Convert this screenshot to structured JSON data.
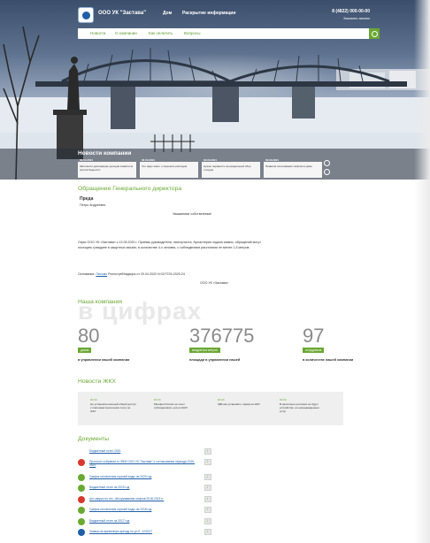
{
  "header": {
    "company": "ООО УК \"Застава\"",
    "nav": [
      "Дом",
      "Раскрытие информации"
    ],
    "phone": "8 (4822) 000-00-00",
    "callback": "Заказать звонок"
  },
  "menu": {
    "items": [
      "Новости",
      "О компании",
      "Как оплатить",
      "Вопросы"
    ]
  },
  "news": {
    "title": "Новости компании",
    "items": [
      {
        "date": "00.00.2021",
        "text": "Заполните декларацию доходов заявителя против бедности"
      },
      {
        "date": "00.00.2021",
        "text": "Что надо знать о переносе расходов"
      },
      {
        "date": "00.00.2021",
        "text": "Нужно перевести на раздельный сбор отходов"
      },
      {
        "date": "00.00.2021",
        "text": "Правила пользования лифтом в доме"
      }
    ]
  },
  "director": {
    "heading": "Обращение Генерального директора",
    "name": "Преда",
    "patronymic": "Петро Андреевич",
    "greeting": "Уважаемые собственники!",
    "body_line1": "Офис ООО УК «Застава» с 12.05.2020 г. Приемы руководителя, паспортиста, бухгалтерия подача заявок, обращений могут",
    "body_line2": "посещать граждане в защитных масках, в количестве 4-х человек, с соблюдением расстояния не менее 1,5 метров.",
    "basis_prefix": "Основание: ",
    "basis_link": "Письмо",
    "basis_rest": " Роспотребнадзора от 20.04.2020 N 02/7376-2020-24",
    "signature": "ООО УК «Застава»"
  },
  "stats": {
    "heading": "Наша компания",
    "watermark": "в цифрах",
    "items": [
      {
        "number": "80",
        "badge": "домов",
        "desc": "в управлении нашей компании"
      },
      {
        "number": "376775",
        "badge": "квадратных метров",
        "desc": "площади в управлении нашей"
      },
      {
        "number": "97",
        "badge": "сотрудников",
        "desc": "в количестве нашей компании"
      }
    ]
  },
  "zhkh": {
    "heading": "Новости ЖКХ",
    "items": [
      {
        "date": "00.00",
        "text": "Не установлен вечный общий доступ к платежам пресечения счету за ЖКУ"
      },
      {
        "date": "00.00",
        "text": "Минфин России не хочет субсидировать услуги ЖКХ"
      },
      {
        "date": "00.00",
        "text": "ГДБ как установить тариф на ЖКУ"
      },
      {
        "date": "00.00",
        "text": "В различных регионах не будут устройства, но непредвиденных услуг"
      }
    ]
  },
  "documents": {
    "heading": "Документы",
    "items": [
      {
        "icon": "blue",
        "text": "Бюджетный отчет 2020"
      },
      {
        "icon": "red",
        "text": "Протокол собрания от ФФИ ООО УК \"Застава\" о согласовании периода 2020-2021"
      },
      {
        "icon": "green",
        "text": "График отключения горячей воды на 2020 год"
      },
      {
        "icon": "green",
        "text": "Бюджетный отчет за 2019 год"
      },
      {
        "icon": "red",
        "text": "Акт сверки по тех. обслуживанию лифтов 2018-2019 гг."
      },
      {
        "icon": "green",
        "text": "График отключения горячей воды на 2018 год"
      },
      {
        "icon": "green",
        "text": "Бюджетный отчет за 2017 год"
      },
      {
        "icon": "blue",
        "text": "Заявка на временную аренду по ул.Л. 12/2017"
      }
    ]
  },
  "colors": {
    "accent": "#6aa832",
    "link": "#1f5fa8",
    "red": "#d8382c"
  }
}
